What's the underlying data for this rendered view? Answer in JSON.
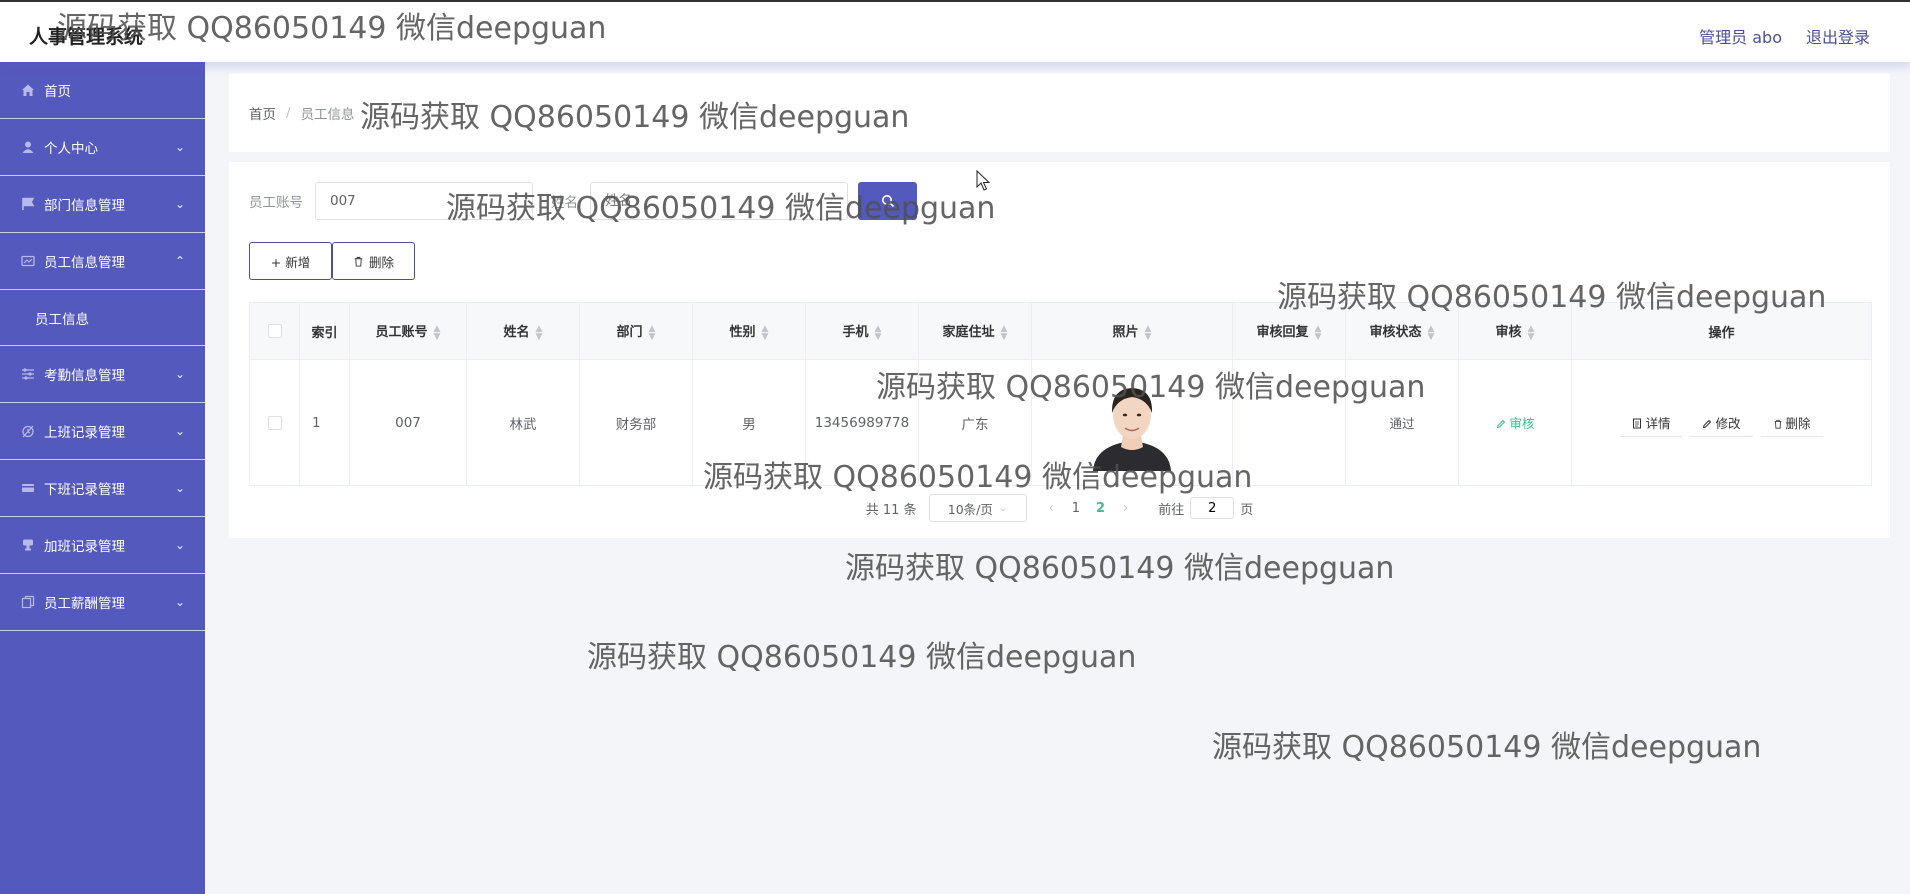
{
  "app": {
    "title": "人事管理系统"
  },
  "header": {
    "user": "管理员 abo",
    "logout": "退出登录"
  },
  "sidebar": {
    "items": [
      {
        "label": "首页",
        "icon": "home-icon"
      },
      {
        "label": "个人中心",
        "icon": "user-icon"
      },
      {
        "label": "部门信息管理",
        "icon": "flag-icon"
      },
      {
        "label": "员工信息管理",
        "icon": "id-card-icon",
        "expanded": true,
        "sub": "员工信息"
      },
      {
        "label": "考勤信息管理",
        "icon": "sliders-icon"
      },
      {
        "label": "上班记录管理",
        "icon": "alarm-icon"
      },
      {
        "label": "下班记录管理",
        "icon": "card-icon"
      },
      {
        "label": "加班记录管理",
        "icon": "mic-icon"
      },
      {
        "label": "员工薪酬管理",
        "icon": "copy-icon"
      }
    ]
  },
  "breadcrumb": {
    "home": "首页",
    "sep": "/",
    "current": "员工信息"
  },
  "search": {
    "label1": "员工账号",
    "value1": "007",
    "label2": "姓名",
    "placeholder2": "姓名"
  },
  "buttons": {
    "add": "+ 新增",
    "delete": "删除"
  },
  "table": {
    "headers": [
      "索引",
      "员工账号",
      "姓名",
      "部门",
      "性别",
      "手机",
      "家庭住址",
      "照片",
      "审核回复",
      "审核状态",
      "审核",
      "操作"
    ],
    "rows": [
      {
        "index": "1",
        "account": "007",
        "name": "林武",
        "dept": "财务部",
        "gender": "男",
        "phone": "13456989778",
        "address": "广东",
        "reply": "",
        "status": "通过",
        "audit": "审核",
        "detail": "详情",
        "edit": "修改",
        "del": "删除"
      }
    ]
  },
  "pagination": {
    "total": "共 11 条",
    "page_size": "10条/页",
    "pages": [
      "1",
      "2"
    ],
    "current": "2",
    "goto_label": "前往",
    "goto_value": "2",
    "goto_suffix": "页"
  },
  "watermark": "源码获取 QQ86050149 微信deepguan",
  "colors": {
    "primary": "#5459bd",
    "success": "#3fbc93"
  }
}
